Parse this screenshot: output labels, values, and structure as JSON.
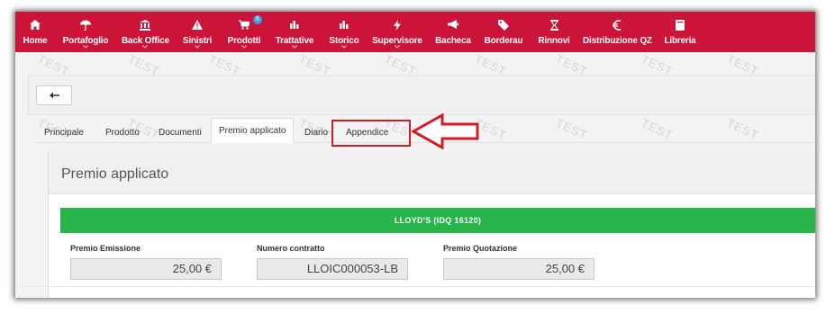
{
  "nav": {
    "items": [
      {
        "label": "Home",
        "icon": "home-icon"
      },
      {
        "label": "Portafoglio",
        "icon": "umbrella-icon"
      },
      {
        "label": "Back Office",
        "icon": "bank-icon"
      },
      {
        "label": "Sinistri",
        "icon": "warning-icon"
      },
      {
        "label": "Prodotti",
        "icon": "cart-icon",
        "badge": "6"
      },
      {
        "label": "Trattative",
        "icon": "chart-icon"
      },
      {
        "label": "Storico",
        "icon": "chart-icon"
      },
      {
        "label": "Supervisore",
        "icon": "bolt-icon"
      },
      {
        "label": "Bacheca",
        "icon": "megaphone-icon"
      },
      {
        "label": "Borderau",
        "icon": "tags-icon"
      },
      {
        "label": "Rinnovi",
        "icon": "hourglass-icon"
      },
      {
        "label": "Distribuzione QZ",
        "icon": "euro-icon"
      },
      {
        "label": "Libreria",
        "icon": "book-icon"
      }
    ]
  },
  "watermark": "TEST",
  "toolbar": {
    "back_icon": "arrow-left-icon"
  },
  "tabs": [
    {
      "label": "Principale"
    },
    {
      "label": "Prodotto"
    },
    {
      "label": "Documenti"
    },
    {
      "label": "Premio applicato",
      "active": true
    },
    {
      "label": "Diario"
    },
    {
      "label": "Appendice",
      "highlighted": true
    }
  ],
  "panel": {
    "title": "Premio applicato",
    "banner": "LLOYD'S (IDQ 16120)",
    "fields": [
      {
        "label": "Premio Emissione",
        "value": "25,00 €"
      },
      {
        "label": "Numero contratto",
        "value": "LLOIC000053-LB"
      },
      {
        "label": "Premio Quotazione",
        "value": "25,00 €"
      }
    ]
  },
  "colors": {
    "nav_bg": "#cc1438",
    "banner_bg": "#28b44a",
    "callout": "#d41b24",
    "badge": "#3a9de0"
  }
}
